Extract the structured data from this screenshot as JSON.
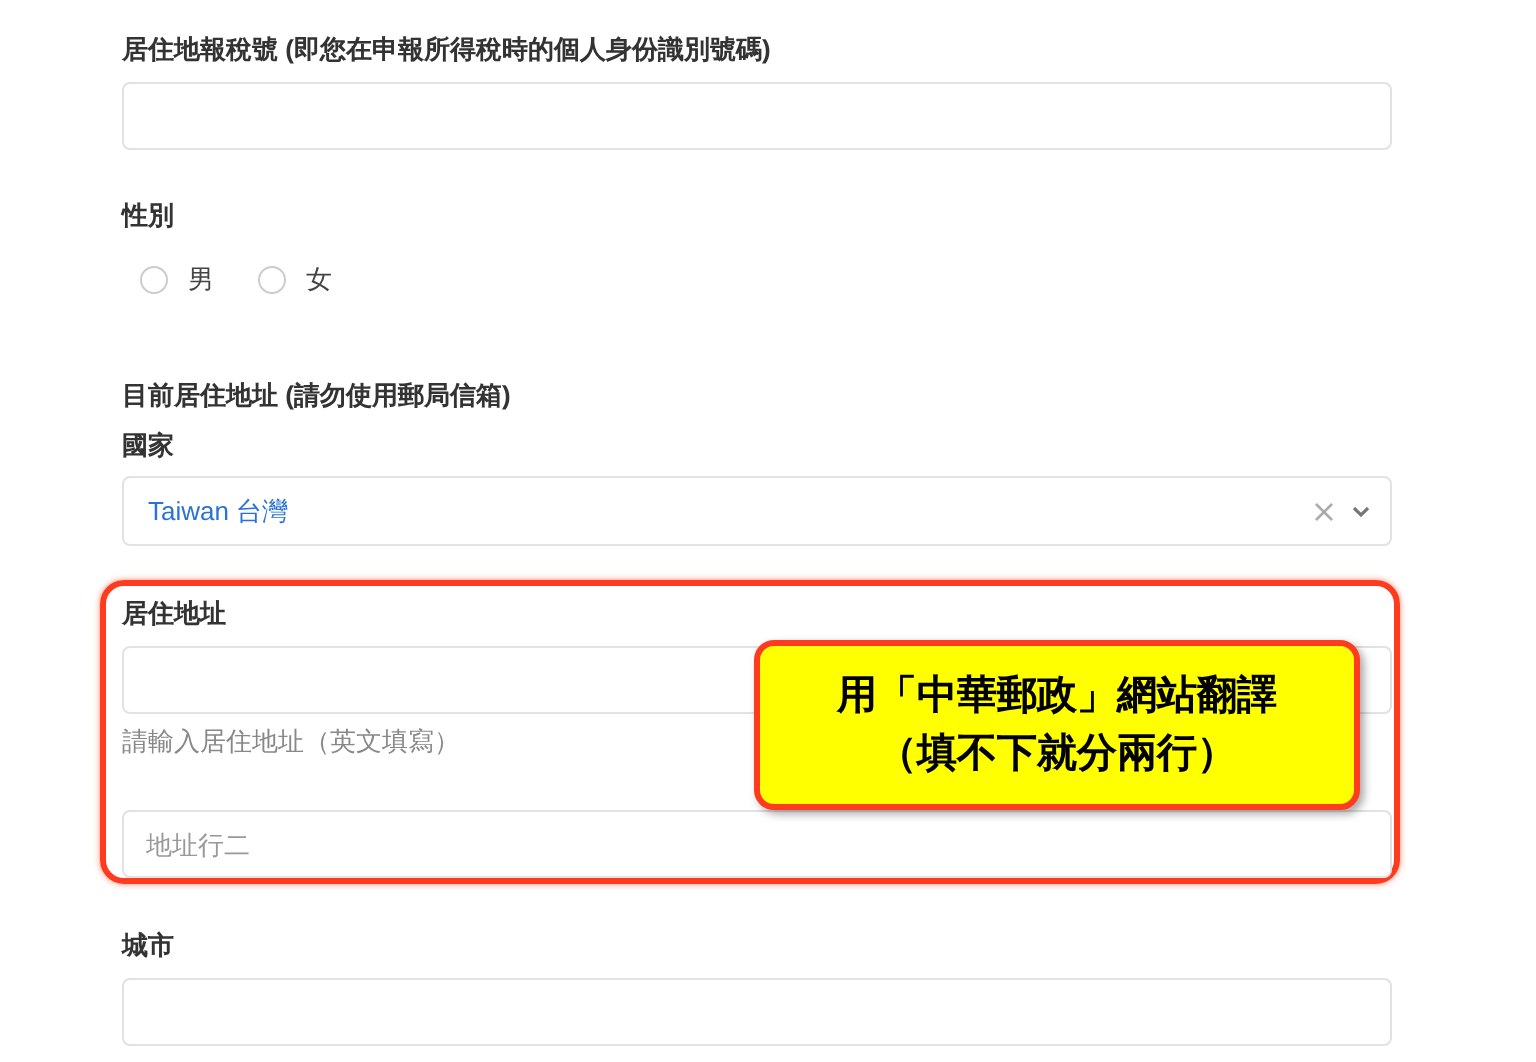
{
  "fields": [
    {
      "kind": "text",
      "label": "居住地報稅號 (即您在申報所得稅時的個人身份識別號碼)"
    },
    {
      "kind": "radio",
      "label": "性別",
      "options": [
        {
          "label": "男",
          "selected": false
        },
        {
          "label": "女",
          "selected": false
        }
      ]
    },
    {
      "kind": "heading",
      "label": "目前居住地址 (請勿使用郵局信箱)"
    },
    {
      "kind": "select",
      "label": "國家",
      "value": "Taiwan 台灣"
    },
    {
      "kind": "address",
      "label": "居住地址",
      "hint": "請輸入居住地址（英文填寫）",
      "line2_placeholder": "地址行二",
      "highlighted": true,
      "callout": [
        "用「中華郵政」網站翻譯",
        "（填不下就分兩行）"
      ]
    },
    {
      "kind": "text",
      "label": "城市"
    }
  ]
}
